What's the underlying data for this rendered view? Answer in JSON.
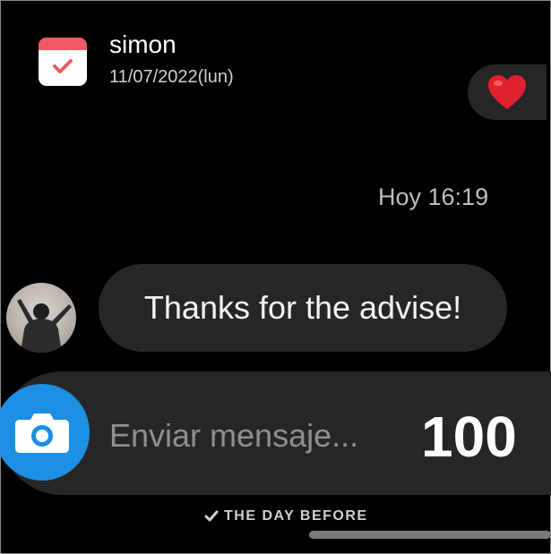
{
  "header": {
    "sender_name": "simon",
    "date": "11/07/2022(lun)",
    "app_icon": "calendar-check-icon"
  },
  "reaction": {
    "emoji": "❤️",
    "icon": "heart-icon"
  },
  "conversation": {
    "timestamp": "Hoy 16:19",
    "message": "Thanks for the advise!"
  },
  "composer": {
    "placeholder": "Enviar mensaje...",
    "camera_icon": "camera-icon",
    "counter": "100"
  },
  "footer": {
    "check_icon": "check-icon",
    "label": "THE DAY BEFORE"
  },
  "colors": {
    "background": "#000000",
    "surface": "#262626",
    "accent_blue": "#1a8fe3",
    "calendar_red": "#ef5a63",
    "heart_red": "#e0202e"
  }
}
